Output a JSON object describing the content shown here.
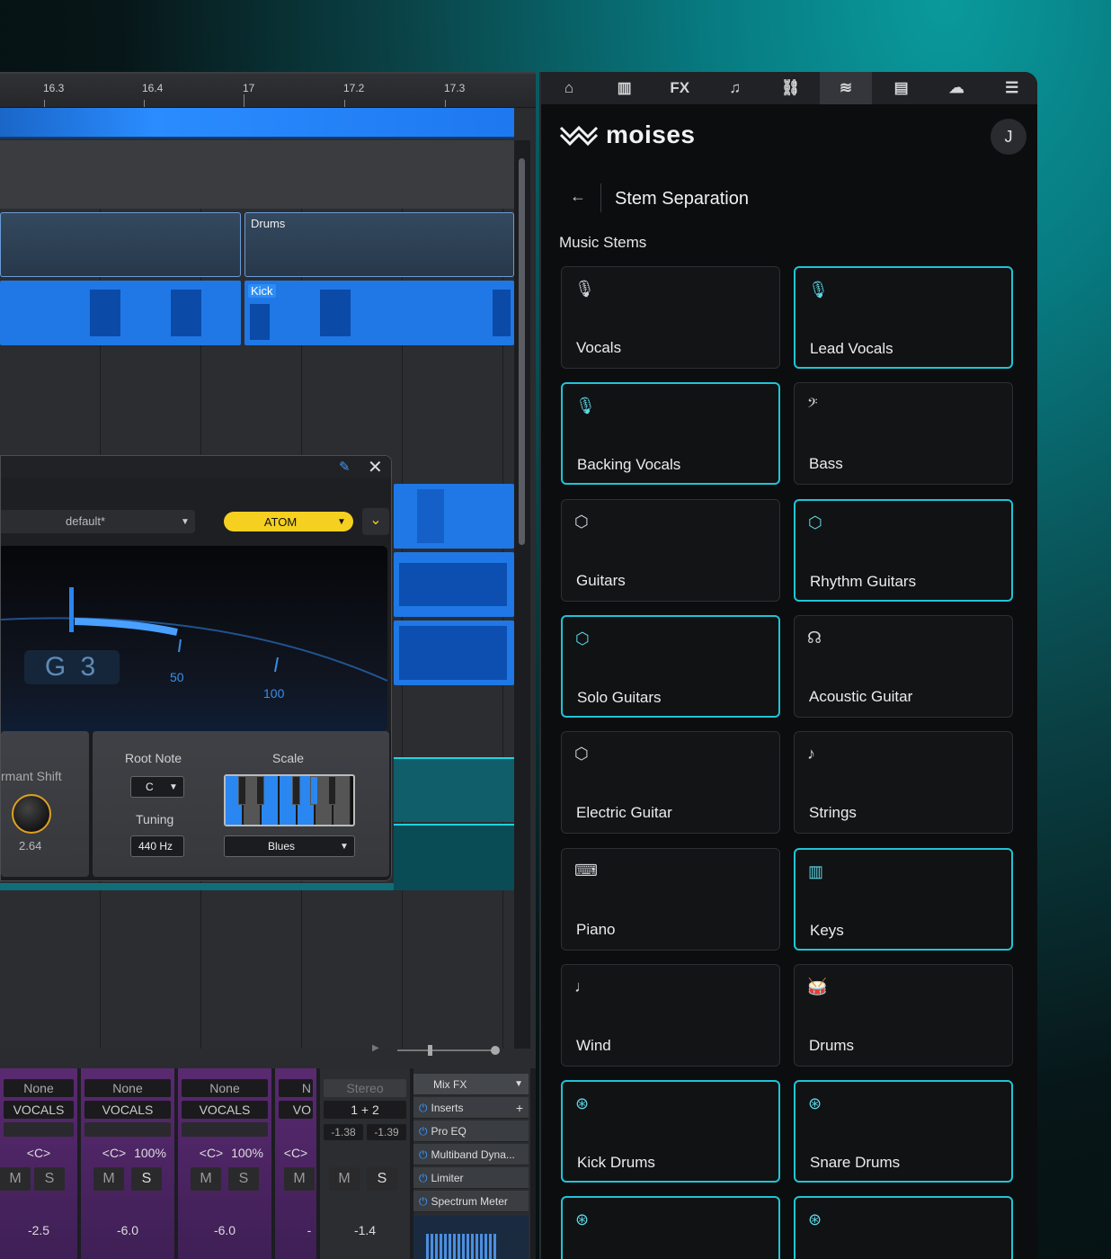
{
  "daw": {
    "ruler": [
      "16.3",
      "16.4",
      "17",
      "17.2",
      "17.3"
    ],
    "clips": {
      "drums": "Drums",
      "kick": "Kick"
    },
    "plugin": {
      "preset": "default*",
      "instrument": "ATOM",
      "note": "G 3",
      "gauge_50": "50",
      "gauge_100": "100",
      "formant_label": "rmant Shift",
      "formant_value": "2.64",
      "root_note_label": "Root Note",
      "root_note_value": "C",
      "tuning_label": "Tuning",
      "tuning_value": "440 Hz",
      "scale_label": "Scale",
      "scale_value": "Blues"
    },
    "mixer": {
      "strips": [
        {
          "input": "None",
          "name": "VOCALS",
          "pan": "<C>",
          "width": "",
          "m": "M",
          "s": "S",
          "level": "-2.5"
        },
        {
          "input": "None",
          "name": "VOCALS",
          "pan": "<C>",
          "width": "100%",
          "m": "M",
          "s": "S",
          "level": "-6.0"
        },
        {
          "input": "None",
          "name": "VOCALS",
          "pan": "<C>",
          "width": "100%",
          "m": "M",
          "s": "S",
          "level": "-6.0"
        },
        {
          "input": "N",
          "name": "VO",
          "pan": "<C>",
          "width": "",
          "m": "M",
          "s": "",
          "level": "-"
        }
      ],
      "stereo": {
        "label": "Stereo",
        "routing": "1 + 2",
        "left": "-1.38",
        "right": "-1.39",
        "m": "M",
        "s": "S",
        "level": "-1.4"
      },
      "fx": {
        "title": "Mix FX",
        "inserts": "Inserts",
        "items": [
          "Pro EQ",
          "Multiband Dyna...",
          "Limiter",
          "Spectrum Meter"
        ]
      }
    }
  },
  "moises": {
    "brand": "moises",
    "avatar_initial": "J",
    "toolbar": [
      {
        "icon": "home-icon",
        "glyph": "⌂"
      },
      {
        "icon": "keyboard-icon",
        "glyph": "▥"
      },
      {
        "icon": "fx-icon",
        "glyph": "FX"
      },
      {
        "icon": "tempo-icon",
        "glyph": "♫"
      },
      {
        "icon": "link-icon",
        "glyph": "⛓"
      },
      {
        "icon": "moises-icon",
        "glyph": "≋"
      },
      {
        "icon": "browser-icon",
        "glyph": "▤"
      },
      {
        "icon": "cloud-icon",
        "glyph": "☁"
      },
      {
        "icon": "list-icon",
        "glyph": "☰"
      }
    ],
    "active_tool": 5,
    "page_title": "Stem Separation",
    "section": "Music Stems",
    "stems": [
      {
        "label": "Vocals",
        "icon": "microphone-icon",
        "glyph": "🎙",
        "selected": false
      },
      {
        "label": "Lead Vocals",
        "icon": "microphone-icon",
        "glyph": "🎙",
        "selected": true
      },
      {
        "label": "Backing Vocals",
        "icon": "microphone-icon",
        "glyph": "🎙",
        "selected": true
      },
      {
        "label": "Bass",
        "icon": "bass-icon",
        "glyph": "𝄢",
        "selected": false
      },
      {
        "label": "Guitars",
        "icon": "guitar-pick-icon",
        "glyph": "⬡",
        "selected": false
      },
      {
        "label": "Rhythm Guitars",
        "icon": "guitar-pick-icon",
        "glyph": "⬡",
        "selected": true
      },
      {
        "label": "Solo Guitars",
        "icon": "guitar-pick-icon",
        "glyph": "⬡",
        "selected": true
      },
      {
        "label": "Acoustic Guitar",
        "icon": "acoustic-guitar-icon",
        "glyph": "☊",
        "selected": false
      },
      {
        "label": "Electric Guitar",
        "icon": "guitar-pick-icon",
        "glyph": "⬡",
        "selected": false
      },
      {
        "label": "Strings",
        "icon": "violin-icon",
        "glyph": "♪",
        "selected": false
      },
      {
        "label": "Piano",
        "icon": "piano-icon",
        "glyph": "⌨",
        "selected": false
      },
      {
        "label": "Keys",
        "icon": "keys-icon",
        "glyph": "▥",
        "selected": true
      },
      {
        "label": "Wind",
        "icon": "trumpet-icon",
        "glyph": "♩",
        "selected": false
      },
      {
        "label": "Drums",
        "icon": "drum-icon",
        "glyph": "🥁",
        "selected": false
      },
      {
        "label": "Kick Drums",
        "icon": "drum-kit-icon",
        "glyph": "⊛",
        "selected": true
      },
      {
        "label": "Snare Drums",
        "icon": "drum-kit-icon",
        "glyph": "⊛",
        "selected": true
      },
      {
        "label": "",
        "icon": "drum-kit-icon",
        "glyph": "⊛",
        "selected": true
      },
      {
        "label": "",
        "icon": "drum-kit-icon",
        "glyph": "⊛",
        "selected": true
      }
    ],
    "colors": {
      "accent": "#1ec5d5",
      "background": "#0c0d0f"
    }
  }
}
